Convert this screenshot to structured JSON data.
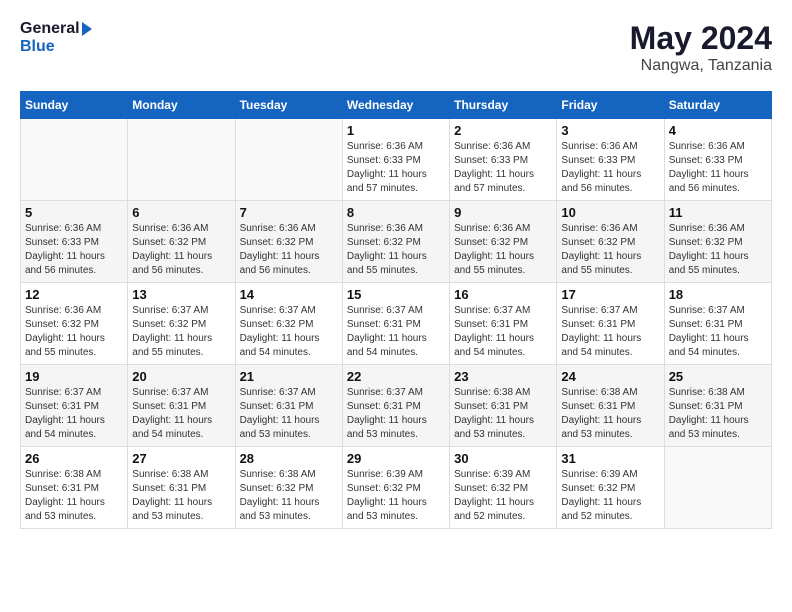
{
  "header": {
    "logo_general": "General",
    "logo_blue": "Blue",
    "title": "May 2024",
    "location": "Nangwa, Tanzania"
  },
  "weekdays": [
    "Sunday",
    "Monday",
    "Tuesday",
    "Wednesday",
    "Thursday",
    "Friday",
    "Saturday"
  ],
  "weeks": [
    [
      {
        "day": "",
        "info": ""
      },
      {
        "day": "",
        "info": ""
      },
      {
        "day": "",
        "info": ""
      },
      {
        "day": "1",
        "info": "Sunrise: 6:36 AM\nSunset: 6:33 PM\nDaylight: 11 hours\nand 57 minutes."
      },
      {
        "day": "2",
        "info": "Sunrise: 6:36 AM\nSunset: 6:33 PM\nDaylight: 11 hours\nand 57 minutes."
      },
      {
        "day": "3",
        "info": "Sunrise: 6:36 AM\nSunset: 6:33 PM\nDaylight: 11 hours\nand 56 minutes."
      },
      {
        "day": "4",
        "info": "Sunrise: 6:36 AM\nSunset: 6:33 PM\nDaylight: 11 hours\nand 56 minutes."
      }
    ],
    [
      {
        "day": "5",
        "info": "Sunrise: 6:36 AM\nSunset: 6:33 PM\nDaylight: 11 hours\nand 56 minutes."
      },
      {
        "day": "6",
        "info": "Sunrise: 6:36 AM\nSunset: 6:32 PM\nDaylight: 11 hours\nand 56 minutes."
      },
      {
        "day": "7",
        "info": "Sunrise: 6:36 AM\nSunset: 6:32 PM\nDaylight: 11 hours\nand 56 minutes."
      },
      {
        "day": "8",
        "info": "Sunrise: 6:36 AM\nSunset: 6:32 PM\nDaylight: 11 hours\nand 55 minutes."
      },
      {
        "day": "9",
        "info": "Sunrise: 6:36 AM\nSunset: 6:32 PM\nDaylight: 11 hours\nand 55 minutes."
      },
      {
        "day": "10",
        "info": "Sunrise: 6:36 AM\nSunset: 6:32 PM\nDaylight: 11 hours\nand 55 minutes."
      },
      {
        "day": "11",
        "info": "Sunrise: 6:36 AM\nSunset: 6:32 PM\nDaylight: 11 hours\nand 55 minutes."
      }
    ],
    [
      {
        "day": "12",
        "info": "Sunrise: 6:36 AM\nSunset: 6:32 PM\nDaylight: 11 hours\nand 55 minutes."
      },
      {
        "day": "13",
        "info": "Sunrise: 6:37 AM\nSunset: 6:32 PM\nDaylight: 11 hours\nand 55 minutes."
      },
      {
        "day": "14",
        "info": "Sunrise: 6:37 AM\nSunset: 6:32 PM\nDaylight: 11 hours\nand 54 minutes."
      },
      {
        "day": "15",
        "info": "Sunrise: 6:37 AM\nSunset: 6:31 PM\nDaylight: 11 hours\nand 54 minutes."
      },
      {
        "day": "16",
        "info": "Sunrise: 6:37 AM\nSunset: 6:31 PM\nDaylight: 11 hours\nand 54 minutes."
      },
      {
        "day": "17",
        "info": "Sunrise: 6:37 AM\nSunset: 6:31 PM\nDaylight: 11 hours\nand 54 minutes."
      },
      {
        "day": "18",
        "info": "Sunrise: 6:37 AM\nSunset: 6:31 PM\nDaylight: 11 hours\nand 54 minutes."
      }
    ],
    [
      {
        "day": "19",
        "info": "Sunrise: 6:37 AM\nSunset: 6:31 PM\nDaylight: 11 hours\nand 54 minutes."
      },
      {
        "day": "20",
        "info": "Sunrise: 6:37 AM\nSunset: 6:31 PM\nDaylight: 11 hours\nand 54 minutes."
      },
      {
        "day": "21",
        "info": "Sunrise: 6:37 AM\nSunset: 6:31 PM\nDaylight: 11 hours\nand 53 minutes."
      },
      {
        "day": "22",
        "info": "Sunrise: 6:37 AM\nSunset: 6:31 PM\nDaylight: 11 hours\nand 53 minutes."
      },
      {
        "day": "23",
        "info": "Sunrise: 6:38 AM\nSunset: 6:31 PM\nDaylight: 11 hours\nand 53 minutes."
      },
      {
        "day": "24",
        "info": "Sunrise: 6:38 AM\nSunset: 6:31 PM\nDaylight: 11 hours\nand 53 minutes."
      },
      {
        "day": "25",
        "info": "Sunrise: 6:38 AM\nSunset: 6:31 PM\nDaylight: 11 hours\nand 53 minutes."
      }
    ],
    [
      {
        "day": "26",
        "info": "Sunrise: 6:38 AM\nSunset: 6:31 PM\nDaylight: 11 hours\nand 53 minutes."
      },
      {
        "day": "27",
        "info": "Sunrise: 6:38 AM\nSunset: 6:31 PM\nDaylight: 11 hours\nand 53 minutes."
      },
      {
        "day": "28",
        "info": "Sunrise: 6:38 AM\nSunset: 6:32 PM\nDaylight: 11 hours\nand 53 minutes."
      },
      {
        "day": "29",
        "info": "Sunrise: 6:39 AM\nSunset: 6:32 PM\nDaylight: 11 hours\nand 53 minutes."
      },
      {
        "day": "30",
        "info": "Sunrise: 6:39 AM\nSunset: 6:32 PM\nDaylight: 11 hours\nand 52 minutes."
      },
      {
        "day": "31",
        "info": "Sunrise: 6:39 AM\nSunset: 6:32 PM\nDaylight: 11 hours\nand 52 minutes."
      },
      {
        "day": "",
        "info": ""
      }
    ]
  ]
}
